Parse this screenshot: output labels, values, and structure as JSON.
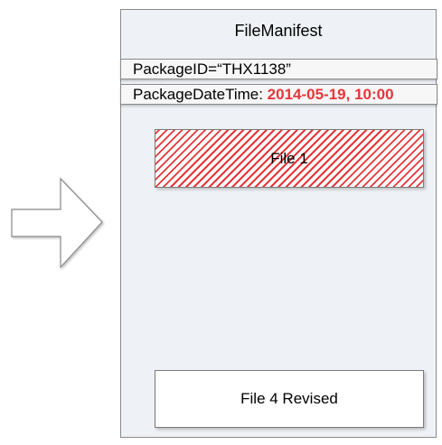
{
  "manifest": {
    "title": "FileManifest",
    "package_id": "PackageID=“THX1138”",
    "package_datetime_label": "PackageDateTime: ",
    "package_datetime_value": "2014-05-19, 10:00"
  },
  "files": [
    {
      "label": "File 1",
      "status": "removed"
    },
    {
      "label": "File 4 Revised",
      "status": "current"
    }
  ],
  "icons": {
    "arrow": "right-arrow-icon"
  },
  "colors": {
    "highlight": "#e8353a",
    "hatch": "#e8353a",
    "panel": "#eef2f6",
    "border": "#8a8a8a"
  }
}
